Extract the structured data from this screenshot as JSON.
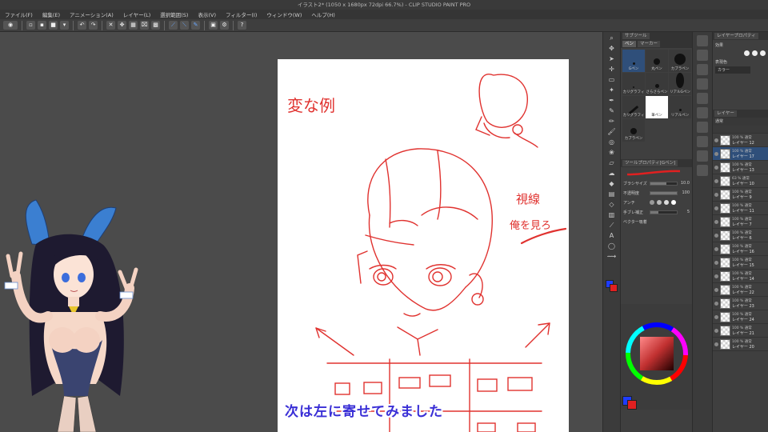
{
  "window": {
    "title": "イラスト2* (1050 x 1680px 72dpi 66.7%) - CLIP STUDIO PAINT PRO"
  },
  "menu": [
    "ファイル(F)",
    "編集(E)",
    "アニメーション(A)",
    "レイヤー(L)",
    "選択範囲(S)",
    "表示(V)",
    "フィルター(I)",
    "ウィンドウ(W)",
    "ヘルプ(H)"
  ],
  "canvas": {
    "annotations": {
      "top_left": "変な例",
      "right_1": "視線",
      "right_2": "俺を見ろ"
    }
  },
  "subtitle": "次は左に寄せてみました",
  "subtool_panel": {
    "tabs": [
      "ペン",
      "マーカー"
    ],
    "header": "サブツール",
    "brushes": [
      {
        "label": "Gペン",
        "selected": true
      },
      {
        "label": "丸ペン",
        "selected": false
      },
      {
        "label": "カブラペン",
        "selected": false
      },
      {
        "label": "カリグラフィ",
        "selected": false
      },
      {
        "label": "さらさらペン",
        "selected": false
      },
      {
        "label": "リアルGペン",
        "selected": false
      },
      {
        "label": "カリグラフィ",
        "selected": false
      },
      {
        "label": "筆ペン",
        "selected": false
      },
      {
        "label": "リアルペン",
        "selected": false
      },
      {
        "label": "カブラペン",
        "selected": false
      }
    ],
    "properties_header": "ツールプロパティ[Gペン]",
    "properties": [
      {
        "label": "ブラシサイズ",
        "value": "10.0",
        "fill": 0.6
      },
      {
        "label": "不透明度",
        "value": "100",
        "fill": 1.0
      },
      {
        "label": "アンチ",
        "value": "",
        "fill": 0.0
      },
      {
        "label": "手ブレ補正",
        "value": "5",
        "fill": 0.3
      },
      {
        "label": "ベクター吸着",
        "value": "",
        "fill": 0.0
      }
    ]
  },
  "layer_props": {
    "header": "レイヤープロパティ",
    "effect_label": "効果",
    "color_label": "表現色",
    "color_value": "カラー"
  },
  "layer_panel": {
    "header": "レイヤー",
    "blend": "通常",
    "layers": [
      {
        "mode": "100 % 通常",
        "name": "レイヤー 12",
        "selected": false
      },
      {
        "mode": "100 % 通常",
        "name": "レイヤー 17",
        "selected": true
      },
      {
        "mode": "100 % 通常",
        "name": "レイヤー 13",
        "selected": false
      },
      {
        "mode": "63 % 通常",
        "name": "レイヤー 10",
        "selected": false
      },
      {
        "mode": "100 % 通常",
        "name": "レイヤー 9",
        "selected": false
      },
      {
        "mode": "100 % 通常",
        "name": "レイヤー 11",
        "selected": false
      },
      {
        "mode": "100 % 通常",
        "name": "レイヤー 7",
        "selected": false
      },
      {
        "mode": "100 % 通常",
        "name": "レイヤー 6",
        "selected": false
      },
      {
        "mode": "100 % 通常",
        "name": "レイヤー 16",
        "selected": false
      },
      {
        "mode": "100 % 通常",
        "name": "レイヤー 15",
        "selected": false
      },
      {
        "mode": "100 % 通常",
        "name": "レイヤー 14",
        "selected": false
      },
      {
        "mode": "100 % 通常",
        "name": "レイヤー 22",
        "selected": false
      },
      {
        "mode": "100 % 通常",
        "name": "レイヤー 23",
        "selected": false
      },
      {
        "mode": "100 % 通常",
        "name": "レイヤー 24",
        "selected": false
      },
      {
        "mode": "100 % 通常",
        "name": "レイヤー 21",
        "selected": false
      },
      {
        "mode": "100 % 通常",
        "name": "レイヤー 20",
        "selected": false
      }
    ]
  },
  "colors": {
    "sketch_red": "#e0322f",
    "subtitle_blue": "#3a2fd6",
    "main_color": "#1e3cff",
    "sub_color": "#e02020",
    "selection": "#2f4f7a"
  }
}
